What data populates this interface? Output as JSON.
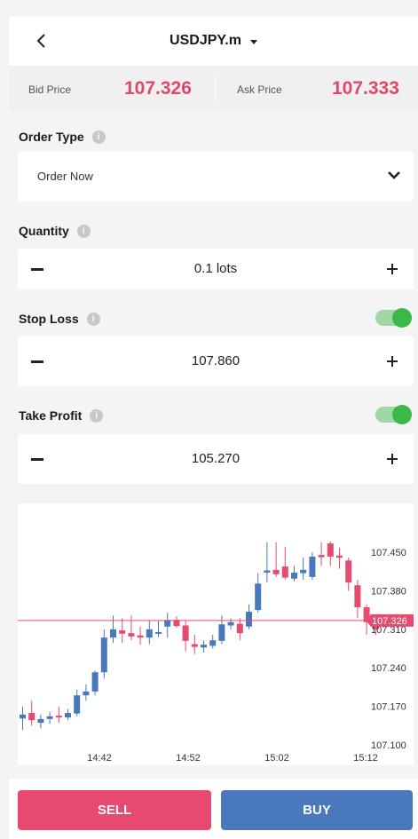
{
  "header": {
    "symbol": "USDJPY.m"
  },
  "prices": {
    "bid_label": "Bid Price",
    "bid_value": "107.326",
    "ask_label": "Ask Price",
    "ask_value": "107.333",
    "color": "#e04868"
  },
  "order_type": {
    "label": "Order Type",
    "value": "Order Now"
  },
  "quantity": {
    "label": "Quantity",
    "value": "0.1 lots"
  },
  "stop_loss": {
    "label": "Stop Loss",
    "value": "107.860",
    "enabled": true
  },
  "take_profit": {
    "label": "Take Profit",
    "value": "105.270",
    "enabled": true
  },
  "chart_data": {
    "type": "candlestick",
    "x_ticks": [
      "14:42",
      "14:52",
      "15:02",
      "15:12"
    ],
    "y_ticks": [
      "107.450",
      "107.380",
      "107.310",
      "107.240",
      "107.170",
      "107.100"
    ],
    "ylim": [
      107.1,
      107.45
    ],
    "current_price_label": "107.326",
    "current_price": 107.326,
    "up_color": "#4a78bc",
    "down_color": "#e64a6e",
    "candles": [
      {
        "o": 107.148,
        "h": 107.17,
        "l": 107.127,
        "c": 107.155
      },
      {
        "o": 107.158,
        "h": 107.18,
        "l": 107.135,
        "c": 107.145
      },
      {
        "o": 107.14,
        "h": 107.155,
        "l": 107.13,
        "c": 107.147
      },
      {
        "o": 107.147,
        "h": 107.16,
        "l": 107.138,
        "c": 107.152
      },
      {
        "o": 107.153,
        "h": 107.17,
        "l": 107.14,
        "c": 107.15
      },
      {
        "o": 107.15,
        "h": 107.165,
        "l": 107.145,
        "c": 107.158
      },
      {
        "o": 107.157,
        "h": 107.2,
        "l": 107.152,
        "c": 107.19
      },
      {
        "o": 107.19,
        "h": 107.21,
        "l": 107.18,
        "c": 107.197
      },
      {
        "o": 107.197,
        "h": 107.235,
        "l": 107.19,
        "c": 107.232
      },
      {
        "o": 107.232,
        "h": 107.31,
        "l": 107.22,
        "c": 107.295
      },
      {
        "o": 107.295,
        "h": 107.335,
        "l": 107.285,
        "c": 107.31
      },
      {
        "o": 107.308,
        "h": 107.33,
        "l": 107.285,
        "c": 107.302
      },
      {
        "o": 107.303,
        "h": 107.335,
        "l": 107.29,
        "c": 107.297
      },
      {
        "o": 107.299,
        "h": 107.315,
        "l": 107.282,
        "c": 107.295
      },
      {
        "o": 107.295,
        "h": 107.325,
        "l": 107.283,
        "c": 107.31
      },
      {
        "o": 107.303,
        "h": 107.325,
        "l": 107.296,
        "c": 107.305
      },
      {
        "o": 107.315,
        "h": 107.34,
        "l": 107.295,
        "c": 107.327
      },
      {
        "o": 107.327,
        "h": 107.334,
        "l": 107.313,
        "c": 107.316
      },
      {
        "o": 107.317,
        "h": 107.325,
        "l": 107.27,
        "c": 107.289
      },
      {
        "o": 107.283,
        "h": 107.3,
        "l": 107.265,
        "c": 107.278
      },
      {
        "o": 107.277,
        "h": 107.29,
        "l": 107.268,
        "c": 107.282
      },
      {
        "o": 107.28,
        "h": 107.3,
        "l": 107.275,
        "c": 107.29
      },
      {
        "o": 107.289,
        "h": 107.335,
        "l": 107.283,
        "c": 107.319
      },
      {
        "o": 107.317,
        "h": 107.33,
        "l": 107.31,
        "c": 107.323
      },
      {
        "o": 107.32,
        "h": 107.33,
        "l": 107.29,
        "c": 107.303
      },
      {
        "o": 107.315,
        "h": 107.355,
        "l": 107.31,
        "c": 107.342
      },
      {
        "o": 107.345,
        "h": 107.412,
        "l": 107.34,
        "c": 107.393
      },
      {
        "o": 107.413,
        "h": 107.468,
        "l": 107.395,
        "c": 107.417
      },
      {
        "o": 107.418,
        "h": 107.468,
        "l": 107.405,
        "c": 107.41
      },
      {
        "o": 107.424,
        "h": 107.46,
        "l": 107.4,
        "c": 107.404
      },
      {
        "o": 107.402,
        "h": 107.425,
        "l": 107.397,
        "c": 107.413
      },
      {
        "o": 107.412,
        "h": 107.44,
        "l": 107.4,
        "c": 107.418
      },
      {
        "o": 107.405,
        "h": 107.45,
        "l": 107.4,
        "c": 107.442
      },
      {
        "o": 107.445,
        "h": 107.468,
        "l": 107.425,
        "c": 107.441
      },
      {
        "o": 107.466,
        "h": 107.47,
        "l": 107.425,
        "c": 107.442
      },
      {
        "o": 107.444,
        "h": 107.458,
        "l": 107.42,
        "c": 107.44
      },
      {
        "o": 107.435,
        "h": 107.44,
        "l": 107.38,
        "c": 107.395
      },
      {
        "o": 107.39,
        "h": 107.4,
        "l": 107.33,
        "c": 107.35
      },
      {
        "o": 107.35,
        "h": 107.355,
        "l": 107.3,
        "c": 107.323
      },
      {
        "o": 107.323,
        "h": 107.33,
        "l": 107.3,
        "c": 107.31
      }
    ]
  },
  "footer": {
    "sell_label": "SELL",
    "buy_label": "BUY"
  }
}
